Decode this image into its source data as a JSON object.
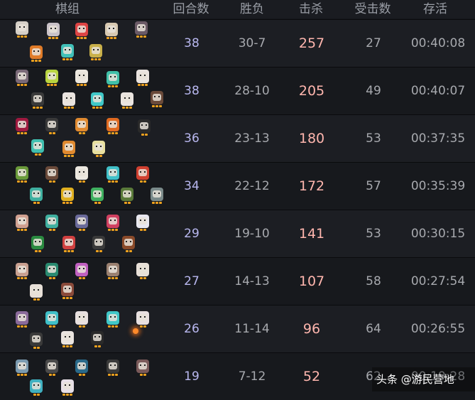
{
  "header": {
    "lineup": "棋组",
    "rounds": "回合数",
    "record": "胜负",
    "kills": "击杀",
    "damage_taken": "受击数",
    "survival": "存活"
  },
  "rows": [
    {
      "rounds": "38",
      "record": "30-7",
      "kills": "257",
      "taken": "27",
      "time": "00:40:08"
    },
    {
      "rounds": "38",
      "record": "28-10",
      "kills": "205",
      "taken": "49",
      "time": "00:40:07"
    },
    {
      "rounds": "36",
      "record": "23-13",
      "kills": "180",
      "taken": "53",
      "time": "00:37:35"
    },
    {
      "rounds": "34",
      "record": "22-12",
      "kills": "172",
      "taken": "57",
      "time": "00:35:39"
    },
    {
      "rounds": "29",
      "record": "19-10",
      "kills": "141",
      "taken": "53",
      "time": "00:30:15"
    },
    {
      "rounds": "27",
      "record": "14-13",
      "kills": "107",
      "taken": "58",
      "time": "00:27:54"
    },
    {
      "rounds": "26",
      "record": "11-14",
      "kills": "96",
      "taken": "64",
      "time": "00:26:55"
    },
    {
      "rounds": "19",
      "record": "7-12",
      "kills": "52",
      "taken": "62",
      "time": "00:19:28"
    }
  ],
  "watermark": "头条 @游民营地",
  "colors": {
    "kills": "#ffb6ae",
    "rounds": "#b9b8f0",
    "text": "#a7a9ae",
    "star": "#f0a21e"
  }
}
